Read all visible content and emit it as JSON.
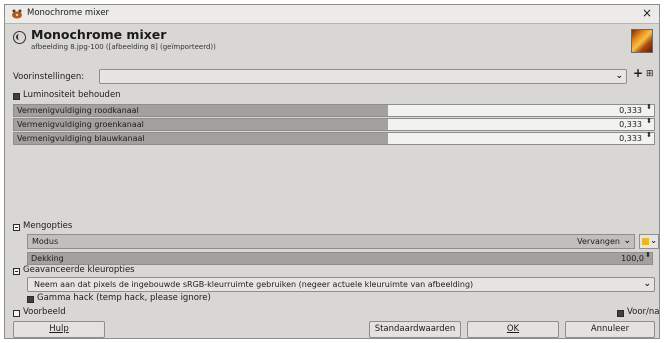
{
  "window": {
    "title": "Monochrome mixer",
    "close_glyph": "×"
  },
  "header": {
    "title": "Monochrome mixer",
    "subtitle": "afbeelding 8.jpg-100 ([afbeelding 8] (geïmporteerd))"
  },
  "presets": {
    "label": "Voorinstellingen:",
    "value": "",
    "add_glyph": "+",
    "menu_glyph": "⊞"
  },
  "preserve_luminosity": {
    "label": "Luminositeit behouden",
    "checked": true
  },
  "channels": [
    {
      "label": "Vermenigvuldiging roodkanaal",
      "value": "0,333",
      "fraction": 0.584
    },
    {
      "label": "Vermenigvuldiging groenkanaal",
      "value": "0,333",
      "fraction": 0.584
    },
    {
      "label": "Vermenigvuldiging blauwkanaal",
      "value": "0,333",
      "fraction": 0.584
    }
  ],
  "blending": {
    "section_label": "Mengopties",
    "mode_label": "Modus",
    "mode_value": "Vervangen",
    "opacity_label": "Dekking",
    "opacity_value": "100,0",
    "opacity_fraction": 1.0
  },
  "advanced": {
    "section_label": "Geavanceerde kleuropties",
    "space_value": "Neem aan dat pixels de ingebouwde sRGB-kleurruimte gebruiken (negeer actuele kleuruimte van afbeelding)",
    "gamma_label": "Gamma hack (temp hack, please ignore)",
    "gamma_checked": true
  },
  "preview": {
    "label": "Voorbeeld",
    "split_label": "Voor/na"
  },
  "buttons": {
    "help": "Hulp",
    "reset": "Standaardwaarden",
    "ok": "OK",
    "cancel": "Annuleer"
  },
  "spin_glyph": "⬍",
  "chevron_glyph": "⌄",
  "colors": {
    "dialog_bg": "#d9d7d3",
    "slider_fill": "#a3a19d",
    "swatch": "#e6b82a"
  }
}
